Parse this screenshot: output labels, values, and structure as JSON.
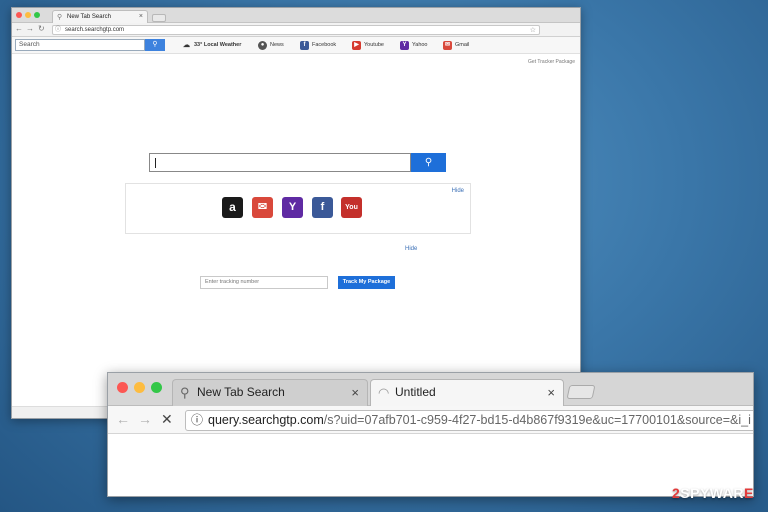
{
  "back_window": {
    "tab": {
      "title": "New Tab Search",
      "close": "×"
    },
    "url": "search.searchgtp.com",
    "search_placeholder": "Search",
    "bookmarks": [
      {
        "label": "33° Local Weather",
        "icon": "weather-icon"
      },
      {
        "label": "News",
        "icon": "news-icon"
      },
      {
        "label": "Facebook",
        "icon": "facebook-icon"
      },
      {
        "label": "Youtube",
        "icon": "youtube-icon"
      },
      {
        "label": "Yahoo",
        "icon": "yahoo-icon"
      },
      {
        "label": "Gmail",
        "icon": "gmail-icon"
      }
    ],
    "get_tracker": "Get Tracker Package",
    "icons_hide": "Hide",
    "tracking_hide": "Hide",
    "tracking_placeholder": "Enter tracking number",
    "track_button": "Track My Package",
    "shortcut_icons": [
      "amazon-icon",
      "mail-icon",
      "yahoo-icon",
      "facebook-icon",
      "youtube-icon"
    ]
  },
  "front_window": {
    "tabs": [
      {
        "title": "New Tab Search",
        "close": "×"
      },
      {
        "title": "Untitled",
        "close": "×"
      }
    ],
    "url_host": "query.searchgtp.com",
    "url_rest": "/s?uid=07afb701-c959-4f27-bd15-d4b867f9319e&uc=17700101&source=&i_i"
  },
  "watermark": {
    "prefix": "2",
    "main": "SPYWAR",
    "suffix": "E"
  },
  "colors": {
    "close_dot": "#fc5753",
    "minimize_dot": "#fdbc40",
    "maximize_dot": "#33c748",
    "accent_blue": "#1e6fd9"
  }
}
